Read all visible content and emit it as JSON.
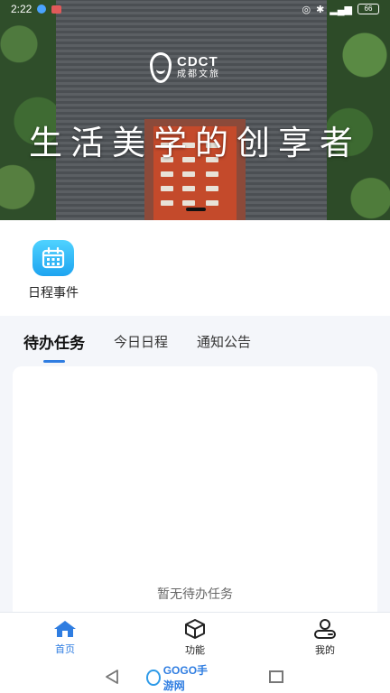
{
  "status_bar": {
    "time": "2:22",
    "battery": "66"
  },
  "banner": {
    "logo_title": "CDCT",
    "logo_subtitle": "成都文旅",
    "slogan": "生活美学的创享者"
  },
  "quick_entries": [
    {
      "label": "日程事件",
      "icon": "calendar-icon"
    }
  ],
  "tabs": [
    {
      "label": "待办任务",
      "active": true
    },
    {
      "label": "今日日程",
      "active": false
    },
    {
      "label": "通知公告",
      "active": false
    }
  ],
  "content": {
    "empty_text": "暂无待办任务"
  },
  "tabbar": [
    {
      "label": "首页",
      "icon": "home-icon",
      "active": true
    },
    {
      "label": "功能",
      "icon": "cube-icon",
      "active": false
    },
    {
      "label": "我的",
      "icon": "user-icon",
      "active": false
    }
  ],
  "system_nav": {
    "home_label": "GOGO手游网"
  },
  "colors": {
    "accent": "#2f7de1",
    "calendar_icon_bg": "#1ea4f0",
    "page_bg": "#f4f6fa"
  }
}
